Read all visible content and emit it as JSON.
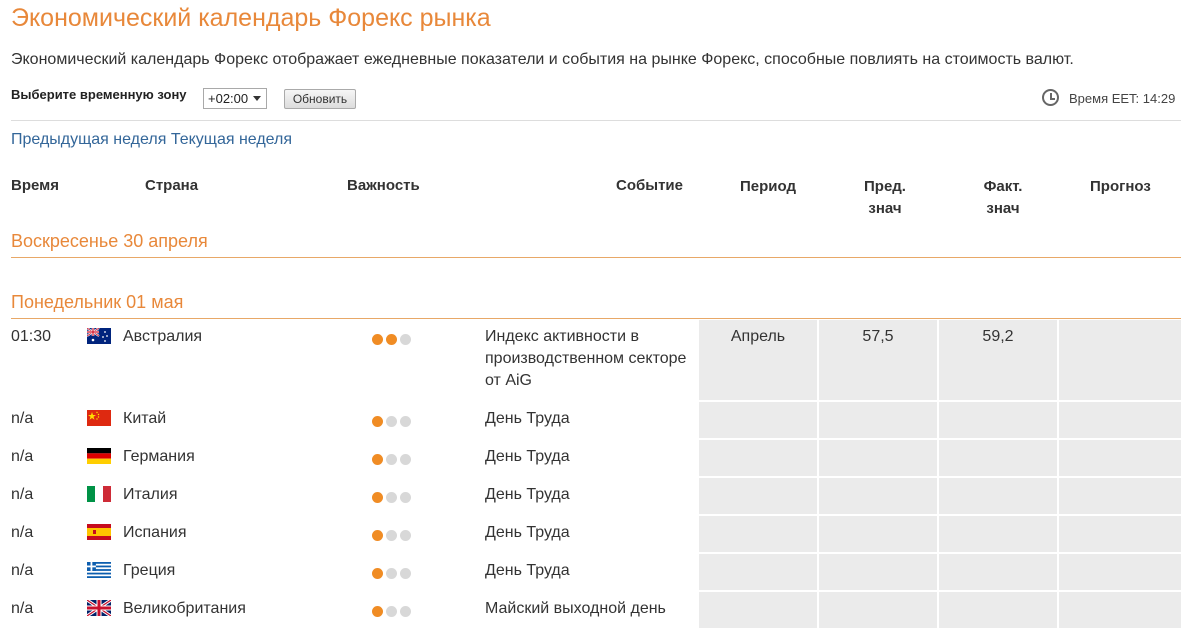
{
  "page": {
    "title": "Экономический календарь Форекс рынка",
    "description": "Экономический календарь Форекс отображает ежедневные показатели и события на рынке Форекс, способные повлиять на стоимость валют."
  },
  "controls": {
    "timezone_label": "Выберите временную зону",
    "timezone_value": "+02:00",
    "refresh_label": "Обновить",
    "server_time": "Время EET: 14:29"
  },
  "week_nav": {
    "previous": "Предыдущая неделя",
    "current": "Текущая неделя"
  },
  "columns": {
    "time": "Время",
    "country": "Страна",
    "importance": "Важность",
    "event": "Событие",
    "period": "Период",
    "previous_l1": "Пред.",
    "previous_l2": "знач",
    "actual_l1": "Факт.",
    "actual_l2": "знач",
    "forecast": "Прогноз"
  },
  "days": [
    {
      "label": "Воскресенье 30 апреля"
    },
    {
      "label": "Понедельник 01 мая"
    }
  ],
  "colors": {
    "accent": "#e8883a",
    "importance_on": "#f08c24",
    "importance_off": "#d8d8d8",
    "link": "#336699",
    "data_cell_bg": "#ebebeb"
  },
  "events": [
    {
      "time": "01:30",
      "flag": "flag-australia-icon",
      "country": "Австралия",
      "importance": 2,
      "event_lines": [
        "Индекс активности в",
        "производственном секторе",
        "от AiG"
      ],
      "period": "Апрель",
      "previous": "57,5",
      "actual": "59,2",
      "forecast": ""
    },
    {
      "time": "n/a",
      "flag": "flag-china-icon",
      "country": "Китай",
      "importance": 1,
      "event_lines": [
        "День Труда"
      ],
      "period": "",
      "previous": "",
      "actual": "",
      "forecast": ""
    },
    {
      "time": "n/a",
      "flag": "flag-germany-icon",
      "country": "Германия",
      "importance": 1,
      "event_lines": [
        "День Труда"
      ],
      "period": "",
      "previous": "",
      "actual": "",
      "forecast": ""
    },
    {
      "time": "n/a",
      "flag": "flag-italy-icon",
      "country": "Италия",
      "importance": 1,
      "event_lines": [
        "День Труда"
      ],
      "period": "",
      "previous": "",
      "actual": "",
      "forecast": ""
    },
    {
      "time": "n/a",
      "flag": "flag-spain-icon",
      "country": "Испания",
      "importance": 1,
      "event_lines": [
        "День Труда"
      ],
      "period": "",
      "previous": "",
      "actual": "",
      "forecast": ""
    },
    {
      "time": "n/a",
      "flag": "flag-greece-icon",
      "country": "Греция",
      "importance": 1,
      "event_lines": [
        "День Труда"
      ],
      "period": "",
      "previous": "",
      "actual": "",
      "forecast": ""
    },
    {
      "time": "n/a",
      "flag": "flag-uk-icon",
      "country": "Великобритания",
      "importance": 1,
      "event_lines": [
        "Майский выходной день"
      ],
      "period": "",
      "previous": "",
      "actual": "",
      "forecast": ""
    }
  ]
}
